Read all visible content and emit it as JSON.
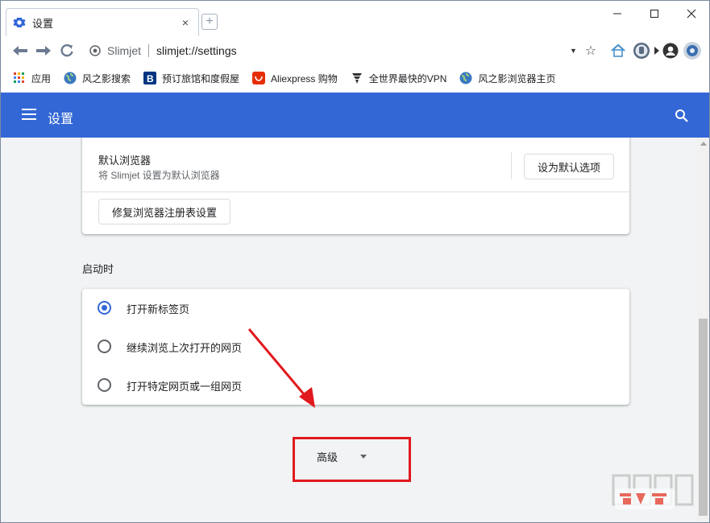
{
  "browser": {
    "tab_title": "设置",
    "tab_close": "×",
    "new_tab": "+",
    "site_name": "Slimjet",
    "url": "slimjet://settings",
    "dropdown": "▼",
    "star": "☆"
  },
  "bookmarks": [
    {
      "label": "应用",
      "icon": "apps-grid-icon"
    },
    {
      "label": "风之影搜索",
      "icon": "globe-icon"
    },
    {
      "label": "预订旅馆和度假屋",
      "icon": "booking-icon"
    },
    {
      "label": "Aliexpress 购物",
      "icon": "aliexpress-icon"
    },
    {
      "label": "全世界最快的VPN",
      "icon": "vpn-icon"
    },
    {
      "label": "风之影浏览器主页",
      "icon": "globe-icon"
    }
  ],
  "header": {
    "title": "设置"
  },
  "default_browser": {
    "title": "默认浏览器",
    "description": "将 Slimjet 设置为默认浏览器",
    "set_default_button": "设为默认选项",
    "repair_button": "修复浏览器注册表设置"
  },
  "startup": {
    "section_title": "启动时",
    "options": [
      {
        "label": "打开新标签页",
        "selected": true
      },
      {
        "label": "继续浏览上次打开的网页",
        "selected": false
      },
      {
        "label": "打开特定网页或一组网页",
        "selected": false
      }
    ]
  },
  "advanced": {
    "label": "高级"
  },
  "colors": {
    "accent": "#3367d6",
    "highlight": "#e0191e"
  }
}
